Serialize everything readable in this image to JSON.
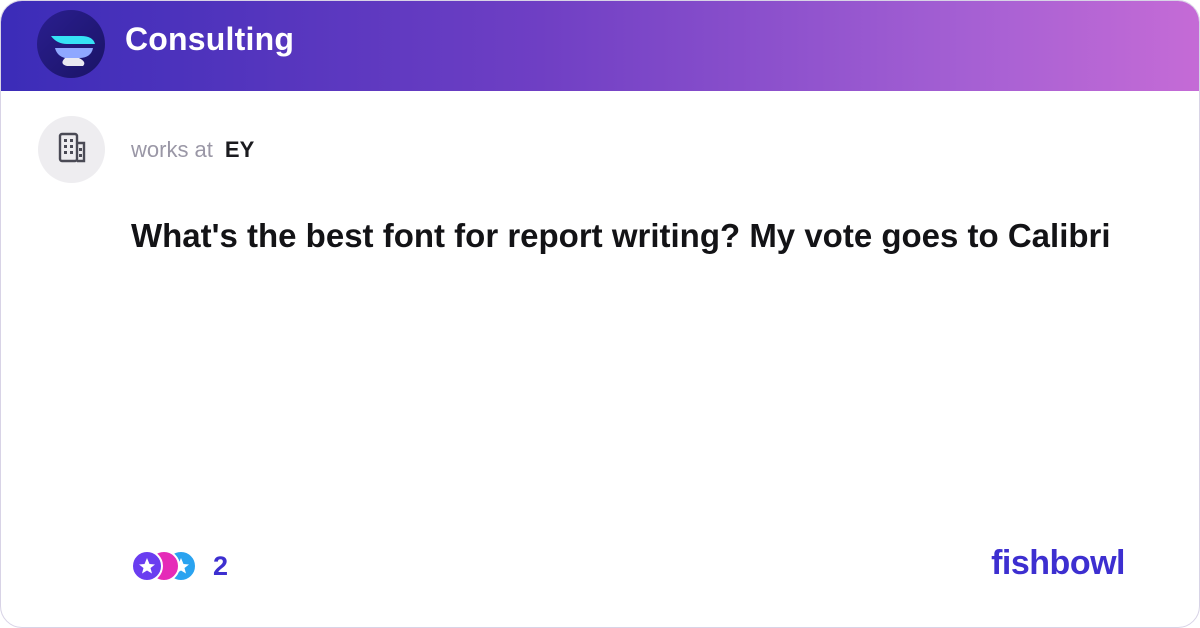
{
  "header": {
    "bowl_name": "Consulting",
    "logo_icon": "bowl-logo-icon",
    "gradient": [
      "#3b2cb8",
      "#c56bd6"
    ]
  },
  "post": {
    "author_icon": "building-icon",
    "works_at_label": "works at",
    "company": "EY",
    "text": "What's the best font for report writing? My vote goes to Calibri"
  },
  "reactions": {
    "icons": [
      "reaction-icon-a",
      "reaction-icon-b",
      "reaction-icon-c"
    ],
    "count": "2"
  },
  "brand": {
    "name": "fishbowl",
    "color": "#3d2fd0"
  }
}
